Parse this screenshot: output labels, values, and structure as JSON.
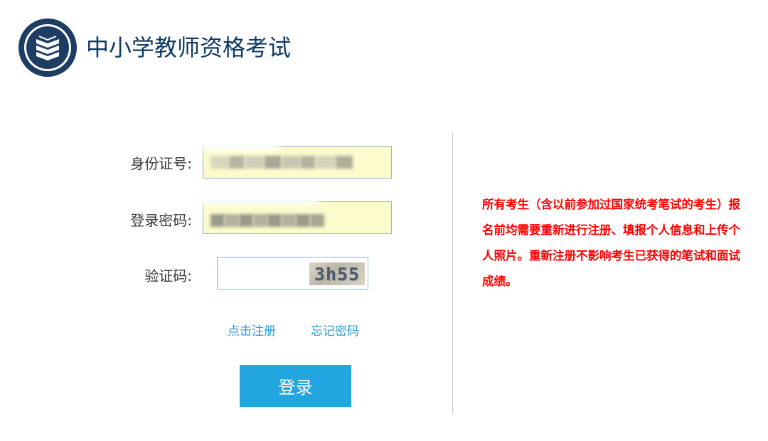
{
  "header": {
    "title": "中小学教师资格考试",
    "logo_icon": "exam-emblem-icon"
  },
  "form": {
    "id_label": "身份证号:",
    "id_value": "",
    "password_label": "登录密码:",
    "password_value": "",
    "captcha_label": "验证码:",
    "captcha_value": "",
    "captcha_image_text": "3h55",
    "register_link": "点击注册",
    "forgot_link": "忘记密码",
    "login_button": "登录"
  },
  "notice": {
    "text": "所有考生（含以前参加过国家统考笔试的考生）报名前均需要重新进行注册、填报个人信息和上传个人照片。重新注册不影响考生已获得的笔试和面试成绩。"
  },
  "colors": {
    "title": "#0f3a63",
    "link": "#2b9bd7",
    "button": "#23a6e0",
    "notice": "#ff0000",
    "field_autofill": "#fbfbcc"
  }
}
